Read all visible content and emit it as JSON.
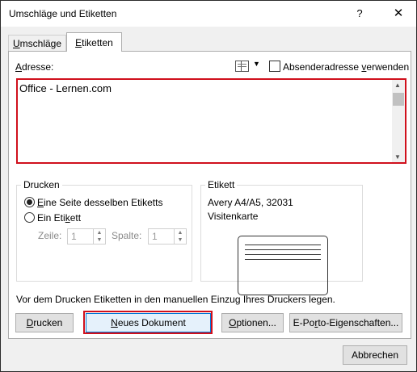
{
  "window": {
    "title": "Umschläge und Etiketten",
    "help": "?",
    "close": "✕"
  },
  "tabs": [
    {
      "label_pre": "",
      "label_ul": "U",
      "label_post": "mschläge"
    },
    {
      "label_pre": "",
      "label_ul": "E",
      "label_post": "tiketten"
    }
  ],
  "address": {
    "label_pre": "",
    "label_ul": "A",
    "label_post": "dresse:",
    "value": "Office - Lernen.com",
    "dropdown": "▼",
    "return_address": {
      "pre": "Absenderadresse ",
      "ul": "v",
      "post": "erwenden",
      "checked": false
    }
  },
  "print_group": {
    "title": "Drucken",
    "option_full": {
      "ul": "E",
      "post": "ine Seite desselben Etiketts",
      "checked": true
    },
    "option_single": {
      "pre": "Ein Eti",
      "ul": "k",
      "post": "ett",
      "checked": false
    },
    "row_label": {
      "pre": "Zeile: ",
      "value": "1"
    },
    "col_label": {
      "pre": "Spalte: ",
      "value": "1"
    }
  },
  "label_group": {
    "title": "Etikett",
    "line1": "Avery A4/A5, 32031",
    "line2": "Visitenkarte"
  },
  "instruction": "Vor dem Drucken Etiketten in den manuellen Einzug Ihres Druckers legen.",
  "buttons": {
    "print": {
      "pre": "",
      "ul": "D",
      "post": "rucken"
    },
    "new_doc": {
      "pre": "",
      "ul": "N",
      "post": "eues Dokument"
    },
    "options": {
      "pre": "",
      "ul": "O",
      "post": "ptionen..."
    },
    "eporto": {
      "pre": "E-Po",
      "ul": "r",
      "post": "to-Eigenschaften..."
    },
    "cancel": "Abbrechen"
  },
  "colors": {
    "highlight": "#d0101c",
    "focus": "#0078d7"
  }
}
